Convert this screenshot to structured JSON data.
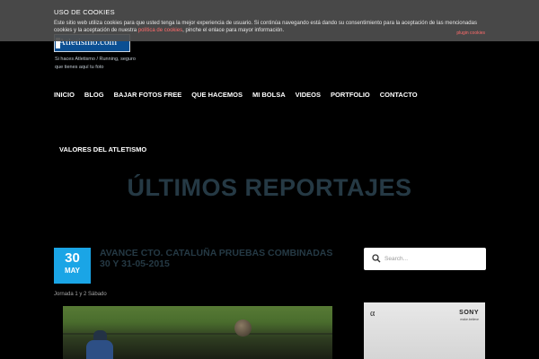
{
  "logo": {
    "text": "Atletismo.com",
    "tagline": "Si haces Atletismo / Running, seguro que tienes aquí tu foto"
  },
  "cookie_bar": {
    "title": "USO DE COOKIES",
    "text": "Este sitio web utiliza cookies para que usted tenga la mejor experiencia de usuario. Si continúa navegando está dando su consentimiento para la aceptación de las mencionadas cookies y la aceptación de nuestra ",
    "link_label": "política de cookies",
    "text_end": ", pinche el enlace para mayor información.",
    "plugin_label": "plugin cookies"
  },
  "nav": {
    "items": [
      {
        "label": "INICIO"
      },
      {
        "label": "BLOG"
      },
      {
        "label": "BAJAR FOTOS FREE"
      },
      {
        "label": "QUE HACEMOS"
      },
      {
        "label": "MI BOLSA"
      },
      {
        "label": "VIDEOS"
      },
      {
        "label": "PORTFOLIO"
      },
      {
        "label": "CONTACTO"
      }
    ],
    "second_row_label": "VALORES DEL ATLETISMO"
  },
  "section_title": "ÚLTIMOS REPORTAJES",
  "post": {
    "day": "30",
    "month": "MAY",
    "title": "AVANCE CTO. CATALUÑA PRUEBAS COMBINADAS 30 Y 31-05-2015",
    "meta": "Jornada 1 y 2 Sábado"
  },
  "sidebar": {
    "search_placeholder": "Search...",
    "ad": {
      "alpha": "α",
      "brand": "SONY",
      "slogan": "make.believe"
    }
  },
  "colors": {
    "accent": "#1aa5e6",
    "title_dark": "#253944",
    "cookie_link": "#ff6b6b",
    "logo_bg": "#0b4f93"
  }
}
